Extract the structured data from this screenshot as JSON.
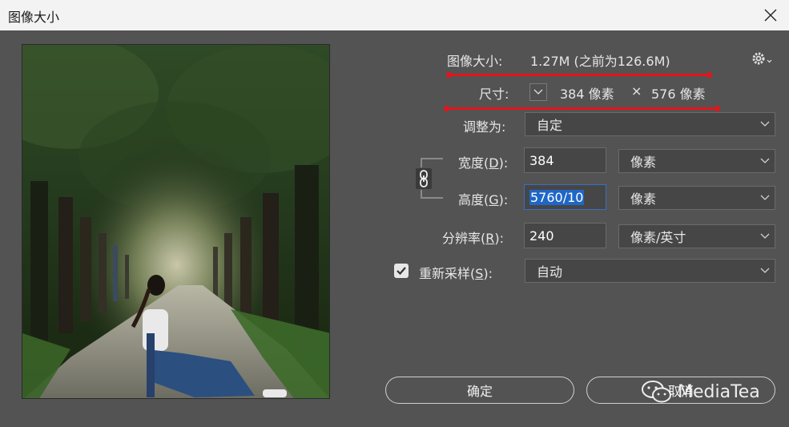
{
  "window": {
    "title": "图像大小",
    "close_icon": "close-icon"
  },
  "info": {
    "size_label": "图像大小:",
    "size_value": "1.27M (之前为126.6M)",
    "dimensions_label": "尺寸:",
    "width_text": "384 像素",
    "times": "×",
    "height_text": "576 像素",
    "highlight_color": "#e3141b"
  },
  "fit_to": {
    "label": "调整为:",
    "value": "自定"
  },
  "width": {
    "label_pre": "宽度(",
    "accel": "D",
    "label_post": "):",
    "value": "384",
    "unit": "像素"
  },
  "height": {
    "label_pre": "高度(",
    "accel": "G",
    "label_post": "):",
    "value": "5760/10",
    "unit": "像素"
  },
  "resolution": {
    "label_pre": "分辨率(",
    "accel": "R",
    "label_post": "):",
    "value": "240",
    "unit": "像素/英寸"
  },
  "resample": {
    "checked": true,
    "label_pre": "重新采样(",
    "accel": "S",
    "label_post": "):",
    "value": "自动"
  },
  "buttons": {
    "ok": "确定",
    "cancel": "取消"
  },
  "watermark": {
    "text": "MediaTea"
  },
  "colors": {
    "dialog_bg": "#535353",
    "field_bg": "#464646",
    "selection": "#1f67c7"
  }
}
